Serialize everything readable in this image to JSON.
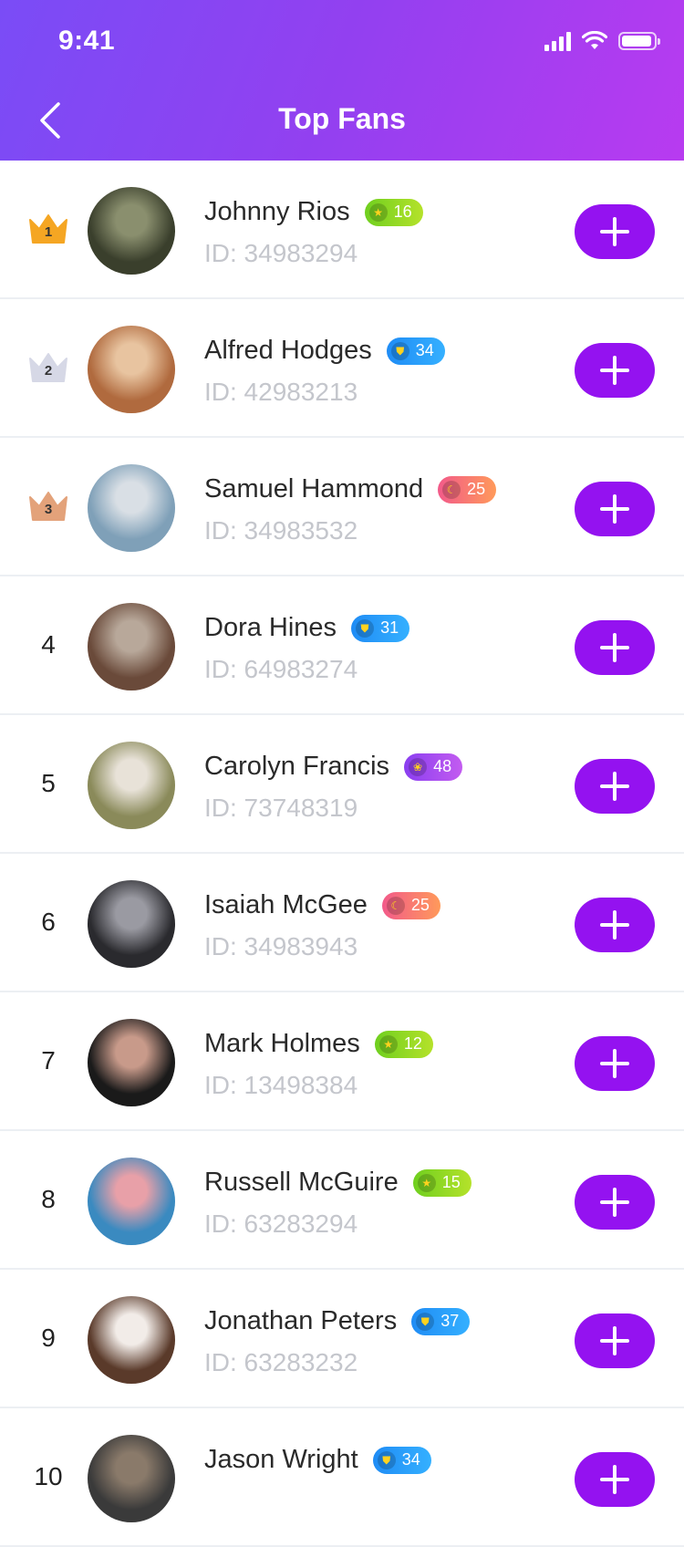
{
  "status_bar": {
    "time": "9:41"
  },
  "header": {
    "title": "Top Fans"
  },
  "fans": [
    {
      "rank": "1",
      "name": "Johnny Rios",
      "id": "ID: 34983294",
      "badge_level": "16",
      "badge_type": "star",
      "badge_colors": [
        "#6fcf1f",
        "#b5e22a"
      ],
      "avatar_colors": [
        "#3a3f2c",
        "#8a8f6e"
      ]
    },
    {
      "rank": "2",
      "name": "Alfred Hodges",
      "id": "ID: 42983213",
      "badge_level": "34",
      "badge_type": "shield",
      "badge_colors": [
        "#1f8cf5",
        "#35b0ff"
      ],
      "avatar_colors": [
        "#b06a3e",
        "#e8c4a0"
      ]
    },
    {
      "rank": "3",
      "name": "Samuel Hammond",
      "id": "ID: 34983532",
      "badge_level": "25",
      "badge_type": "moon",
      "badge_colors": [
        "#f25a8a",
        "#ff9a5a"
      ],
      "avatar_colors": [
        "#7fa0b8",
        "#d9dfe5"
      ]
    },
    {
      "rank": "4",
      "name": "Dora Hines",
      "id": "ID: 64983274",
      "badge_level": "31",
      "badge_type": "shield",
      "badge_colors": [
        "#1f8cf5",
        "#35b0ff"
      ],
      "avatar_colors": [
        "#6a4a3a",
        "#b8a89a"
      ]
    },
    {
      "rank": "5",
      "name": "Carolyn Francis",
      "id": "ID: 73748319",
      "badge_level": "48",
      "badge_type": "paw",
      "badge_colors": [
        "#8a3ef0",
        "#c35cf0"
      ],
      "avatar_colors": [
        "#8a8a5a",
        "#e8e2d8"
      ]
    },
    {
      "rank": "6",
      "name": "Isaiah McGee",
      "id": "ID: 34983943",
      "badge_level": "25",
      "badge_type": "moon",
      "badge_colors": [
        "#f25a8a",
        "#ff9a5a"
      ],
      "avatar_colors": [
        "#2a2a2e",
        "#9a9aa2"
      ]
    },
    {
      "rank": "7",
      "name": "Mark Holmes",
      "id": "ID: 13498384",
      "badge_level": "12",
      "badge_type": "star",
      "badge_colors": [
        "#6fcf1f",
        "#b5e22a"
      ],
      "avatar_colors": [
        "#1a1a1a",
        "#c89a8a"
      ]
    },
    {
      "rank": "8",
      "name": "Russell McGuire",
      "id": "ID: 63283294",
      "badge_level": "15",
      "badge_type": "star",
      "badge_colors": [
        "#6fcf1f",
        "#b5e22a"
      ],
      "avatar_colors": [
        "#3a8ac0",
        "#e8a0a8"
      ]
    },
    {
      "rank": "9",
      "name": "Jonathan Peters",
      "id": "ID: 63283232",
      "badge_level": "37",
      "badge_type": "shield",
      "badge_colors": [
        "#1f8cf5",
        "#35b0ff"
      ],
      "avatar_colors": [
        "#5a3a2a",
        "#f2ece8"
      ]
    },
    {
      "rank": "10",
      "name": "Jason Wright",
      "id": "",
      "badge_level": "34",
      "badge_type": "shield",
      "badge_colors": [
        "#1f8cf5",
        "#35b0ff"
      ],
      "avatar_colors": [
        "#3a3a3a",
        "#8a7a6a"
      ]
    }
  ],
  "colors": {
    "accent": "#9412f0",
    "header_gradient": [
      "#7a4cf6",
      "#b83bf0"
    ],
    "crown_gold": "#f5a623",
    "crown_silver": "#d6d8e6",
    "crown_bronze": "#e3a27a"
  }
}
